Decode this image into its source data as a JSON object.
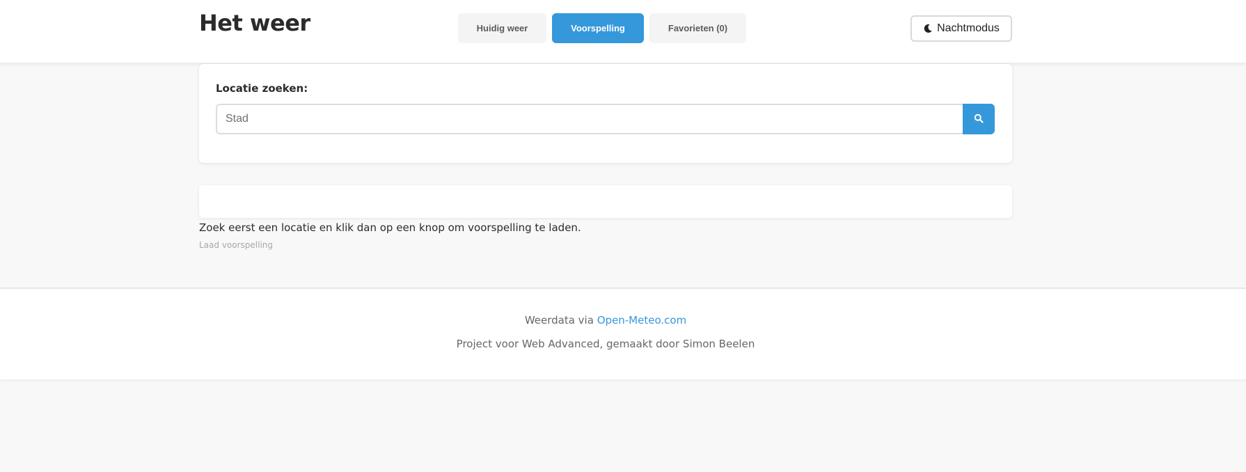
{
  "app": {
    "title": "Het weer"
  },
  "tabs": [
    {
      "label": "Huidig weer",
      "active": false
    },
    {
      "label": "Voorspelling",
      "active": true
    },
    {
      "label": "Favorieten (0)",
      "active": false
    }
  ],
  "theme_toggle": {
    "label": "Nachtmodus",
    "icon": "moon-icon"
  },
  "search": {
    "label": "Locatie zoeken:",
    "placeholder": "Stad",
    "value": "",
    "button_icon": "search-icon"
  },
  "forecast": {
    "hint": "Zoek eerst een locatie en klik dan op een knop om voorspelling te laden.",
    "load_label": "Laad voorspelling"
  },
  "footer": {
    "data_prefix": "Weerdata via ",
    "data_link": "Open-Meteo.com",
    "credits": "Project voor Web Advanced, gemaakt door Simon Beelen"
  },
  "colors": {
    "accent": "#3598db",
    "background": "#f8f8f8",
    "surface": "#ffffff"
  }
}
